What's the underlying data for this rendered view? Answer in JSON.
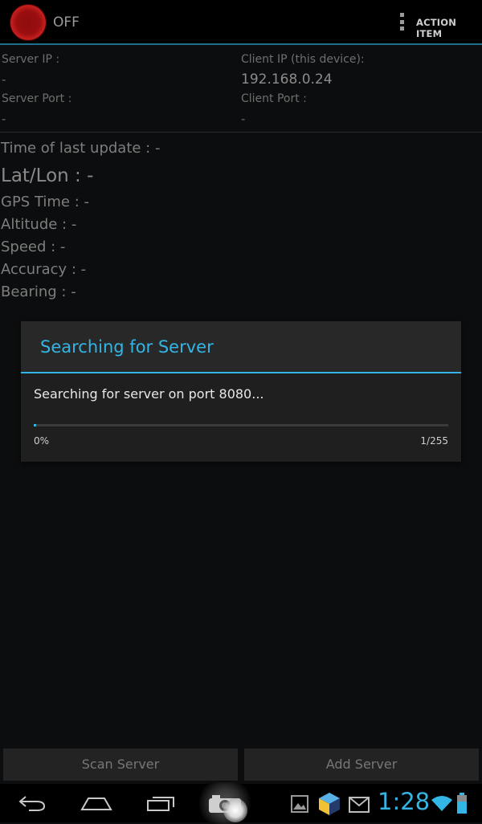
{
  "actionbar": {
    "power_state": "OFF",
    "action_item": "ACTION ITEM"
  },
  "connection": {
    "server_ip_label": "Server IP :",
    "server_ip_value": "-",
    "server_port_label": "Server Port :",
    "server_port_value": "-",
    "client_ip_label": "Client IP (this device):",
    "client_ip_value": "192.168.0.24",
    "client_port_label": "Client Port :",
    "client_port_value": "-"
  },
  "gps": {
    "last_update": "Time of last update : -",
    "latlon": "Lat/Lon : -",
    "gps_time": "GPS Time : -",
    "altitude": "Altitude : -",
    "speed": "Speed : -",
    "accuracy": "Accuracy : -",
    "bearing": "Bearing : -"
  },
  "dialog": {
    "title": "Searching for Server",
    "message": "Searching for server on port 8080...",
    "percent": "0%",
    "count": "1/255",
    "progress_fraction": 0.004
  },
  "buttons": {
    "scan": "Scan Server",
    "add": "Add Server"
  },
  "system_bar": {
    "time": "1:28",
    "icons": [
      "back-icon",
      "home-icon",
      "recent-apps-icon",
      "camera-icon",
      "gallery-icon",
      "app-cube-icon",
      "gmail-icon",
      "wifi-icon",
      "battery-icon"
    ]
  },
  "colors": {
    "accent": "#33b5e5",
    "power_red": "#b01818",
    "background": "#0c0d0e"
  }
}
